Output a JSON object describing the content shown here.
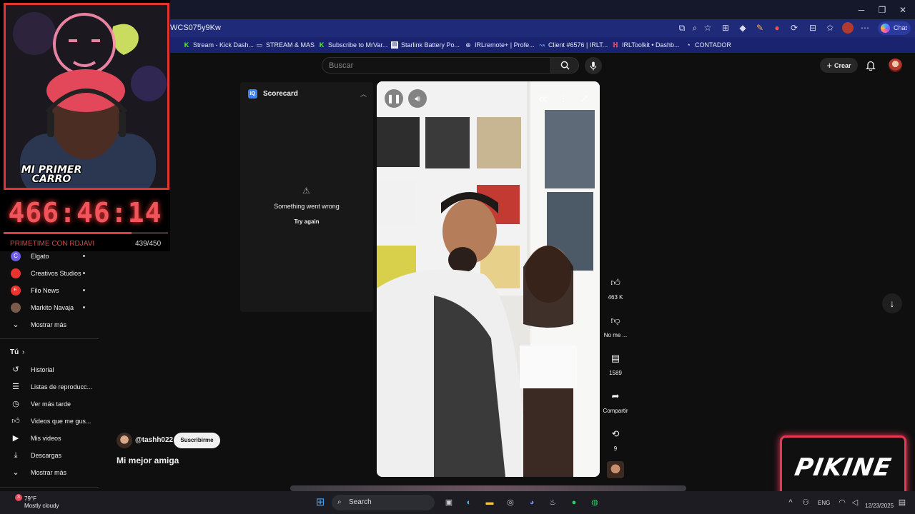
{
  "browser": {
    "url": "WCS075y9Kw",
    "chat_label": "Chat",
    "window_controls": [
      "minimize-icon",
      "restore-icon",
      "close-icon"
    ],
    "toolbar_icons": [
      "open-in-app-icon",
      "zoom-icon",
      "star-icon",
      "extensions-icon",
      "extension-icon",
      "extension-icon",
      "extension-icon",
      "extension-icon",
      "collections-icon",
      "favorites-icon",
      "profile-icon",
      "more-icon"
    ]
  },
  "bookmarks": [
    {
      "label": "Stream - Kick Dash...",
      "icon": "kick-icon",
      "color": "#53fc18"
    },
    {
      "label": "STREAM & MAS",
      "icon": "folder-icon",
      "color": "#e8eaf6"
    },
    {
      "label": "Subscribe to MrVar...",
      "icon": "kick-icon",
      "color": "#53fc18"
    },
    {
      "label": "Starlink Battery Po...",
      "icon": "page-icon",
      "color": "#e8eaf6"
    },
    {
      "label": "IRLremote+ | Profe...",
      "icon": "globe-icon",
      "color": "#e8eaf6"
    },
    {
      "label": "Client #6576 | IRLT...",
      "icon": "link-icon",
      "color": "#6ea8ff"
    },
    {
      "label": "IRLToolkit • Dashb...",
      "icon": "irltoolkit-icon",
      "color": "#ff4d6a"
    },
    {
      "label": "CONTADOR",
      "icon": "contador-icon",
      "color": "#e8eaf6"
    }
  ],
  "youtube": {
    "search_placeholder": "Buscar",
    "create_label": "Crear"
  },
  "overlay": {
    "timer": "466:46:14",
    "progress": 0.78,
    "title_line1": "MI PRIMER",
    "title_line2": "CARRO",
    "stream_label": "PRIMETIME CON RDJAVI",
    "stream_count": "439/450"
  },
  "sidebar": {
    "channels": [
      {
        "label": "Elgato",
        "color": "#6c5ce7"
      },
      {
        "label": "Creativos Studios",
        "color": "#e8342f"
      },
      {
        "label": "Filo News",
        "color": "#e8342f"
      },
      {
        "label": "Markito Navaja",
        "color": "#7a5a4a"
      }
    ],
    "show_more_1": "Mostrar más",
    "you_section": "Tú",
    "you_items": [
      {
        "label": "Historial",
        "icon": "history-icon"
      },
      {
        "label": "Listas de reproducc...",
        "icon": "playlist-icon"
      },
      {
        "label": "Ver más tarde",
        "icon": "clock-icon"
      },
      {
        "label": "Videos que me gus...",
        "icon": "thumbs-up-icon"
      },
      {
        "label": "Mis videos",
        "icon": "my-videos-icon"
      },
      {
        "label": "Descargas",
        "icon": "download-icon"
      }
    ],
    "show_more_2": "Mostrar más"
  },
  "scorecard": {
    "logo": "IQ",
    "title": "Scorecard",
    "error": "Something went wrong",
    "retry": "Try again"
  },
  "short": {
    "channel": "@tashh022",
    "subscribe": "Suscribirme",
    "title": "Mi mejor amiga",
    "likes": "463 K",
    "dislike_label": "No me ...",
    "comments": "1589",
    "share_label": "Compartir",
    "remix_count": "9"
  },
  "brand_overlay": {
    "text": "PIKINE"
  },
  "taskbar": {
    "search_label": "Search",
    "weather_temp": "79°F",
    "weather_desc": "Mostly cloudy",
    "weather_badge": "3",
    "lang": "ENG",
    "date": "12/23/2025"
  }
}
